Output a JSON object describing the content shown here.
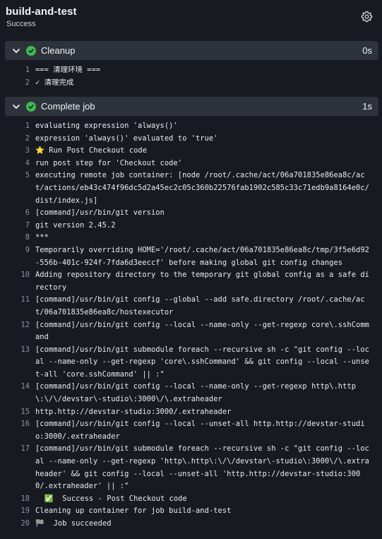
{
  "job": {
    "title": "build-and-test",
    "status": "Success"
  },
  "steps": [
    {
      "name": "Cleanup",
      "duration": "0s",
      "lines": [
        {
          "num": "1",
          "text": "=== 清理环境 ==="
        },
        {
          "num": "2",
          "text": "✓ 清理完成"
        }
      ]
    },
    {
      "name": "Complete job",
      "duration": "1s",
      "lines": [
        {
          "num": "1",
          "text": "evaluating expression 'always()'"
        },
        {
          "num": "2",
          "text": "expression 'always()' evaluated to 'true'"
        },
        {
          "num": "3",
          "text": "⭐ Run Post Checkout code"
        },
        {
          "num": "4",
          "text": "run post step for 'Checkout code'"
        },
        {
          "num": "5",
          "text": "executing remote job container: [node /root/.cache/act/06a701835e86ea8c/act/actions/eb43c474f96dc5d2a45ec2c05c360b22576fab1902c585c33c71edb9a8164e0c/dist/index.js]"
        },
        {
          "num": "6",
          "text": "[command]/usr/bin/git version"
        },
        {
          "num": "7",
          "text": "git version 2.45.2"
        },
        {
          "num": "8",
          "text": "***"
        },
        {
          "num": "9",
          "text": "Temporarily overriding HOME='/root/.cache/act/06a701835e86ea8c/tmp/3f5e6d92-556b-401c-924f-7fda6d3eeccf' before making global git config changes"
        },
        {
          "num": "10",
          "text": "Adding repository directory to the temporary git global config as a safe directory"
        },
        {
          "num": "11",
          "text": "[command]/usr/bin/git config --global --add safe.directory /root/.cache/act/06a701835e86ea8c/hostexecutor"
        },
        {
          "num": "12",
          "text": "[command]/usr/bin/git config --local --name-only --get-regexp core\\.sshCommand"
        },
        {
          "num": "13",
          "text": "[command]/usr/bin/git submodule foreach --recursive sh -c \"git config --local --name-only --get-regexp 'core\\.sshCommand' && git config --local --unset-all 'core.sshCommand' || :\""
        },
        {
          "num": "14",
          "text": "[command]/usr/bin/git config --local --name-only --get-regexp http\\.http\\:\\/\\/devstar\\-studio\\:3000\\/\\.extraheader"
        },
        {
          "num": "15",
          "text": "http.http://devstar-studio:3000/.extraheader"
        },
        {
          "num": "16",
          "text": "[command]/usr/bin/git config --local --unset-all http.http://devstar-studio:3000/.extraheader"
        },
        {
          "num": "17",
          "text": "[command]/usr/bin/git submodule foreach --recursive sh -c \"git config --local --name-only --get-regexp 'http\\.http\\:\\/\\/devstar\\-studio\\:3000\\/\\.extraheader' && git config --local --unset-all 'http.http://devstar-studio:3000/.extraheader' || :\""
        },
        {
          "num": "18",
          "text": "  ✅  Success - Post Checkout code"
        },
        {
          "num": "19",
          "text": "Cleaning up container for job build-and-test"
        },
        {
          "num": "20",
          "text": "🏁  Job succeeded"
        }
      ]
    }
  ],
  "colors": {
    "accent_success": "#3fb950",
    "background": "#171b21",
    "step_header": "#2d333b"
  },
  "icons": {
    "settings": "gear-icon",
    "expand": "chevron-down-icon",
    "status": "check-circle-icon"
  }
}
